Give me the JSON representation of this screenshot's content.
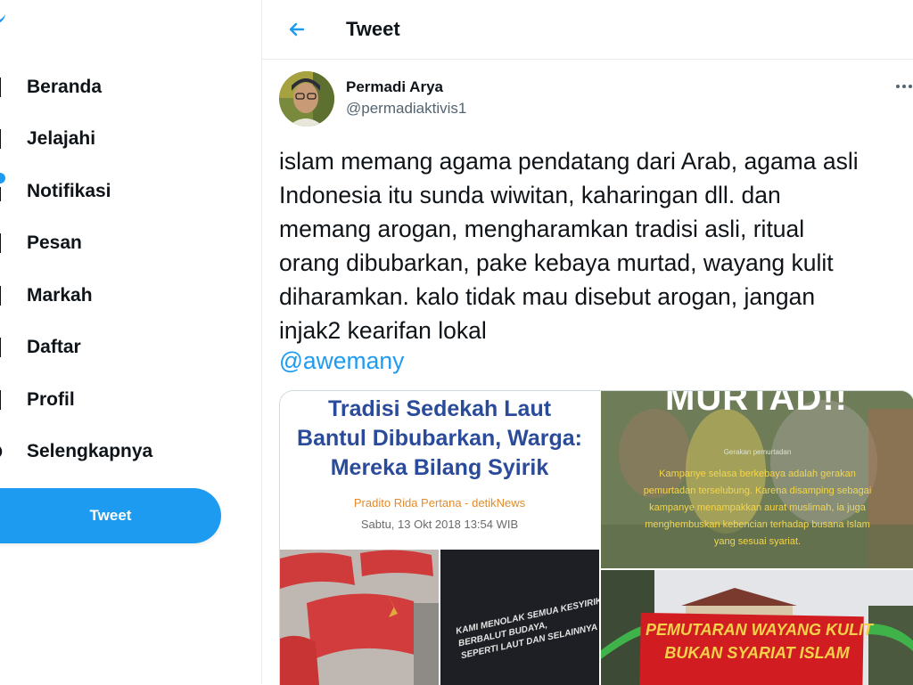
{
  "sidebar": {
    "items": [
      {
        "label": "Beranda",
        "icon": "home-icon"
      },
      {
        "label": "Jelajahi",
        "icon": "hashtag-icon"
      },
      {
        "label": "Notifikasi",
        "icon": "bell-icon"
      },
      {
        "label": "Pesan",
        "icon": "mail-icon"
      },
      {
        "label": "Markah",
        "icon": "bookmark-icon"
      },
      {
        "label": "Daftar",
        "icon": "list-icon"
      },
      {
        "label": "Profil",
        "icon": "profile-icon"
      },
      {
        "label": "Selengkapnya",
        "icon": "more-circle-icon"
      }
    ],
    "tweet_button": "Tweet"
  },
  "header": {
    "title": "Tweet"
  },
  "tweet": {
    "author_name": "Permadi Arya",
    "author_handle": "@permadiaktivis1",
    "text_lines": [
      "islam memang agama pendatang dari Arab, agama asli",
      "Indonesia itu sunda wiwitan, kaharingan dll. dan",
      "memang arogan, mengharamkan tradisi asli, ritual",
      "orang dibubarkan, pake kebaya murtad, wayang kulit",
      "diharamkan. kalo tidak mau disebut arogan, jangan",
      "injak2 kearifan lokal"
    ],
    "mention": "@awemany"
  },
  "media": {
    "news": {
      "title_lines": [
        "Tradisi Sedekah Laut",
        "Bantul Dibubarkan, Warga:",
        "Mereka Bilang Syirik"
      ],
      "author": "Pradito Rida Pertana - detikNews",
      "date": "Sabtu, 13 Okt 2018 13:54 WIB",
      "sign_lines": [
        "KAMI MENOLAK SEMUA KESYIRIKAN",
        "BERBALUT BUDAYA,",
        "SEPERTI LAUT DAN SELAINNYA"
      ]
    },
    "murtad": {
      "heading": "MURTAD!!",
      "small_label": "Gerakan pemurtadan",
      "lines": [
        "Kampanye selasa berkebaya  adalah gerakan",
        "pemurtadan terselubung. Karena disamping sebagai",
        "kampanye menampakkan aurat muslimah, ia juga",
        "menghembuskan kebencian terhadap busana Islam",
        "yang sesuai syariat."
      ]
    },
    "banner": {
      "lines": [
        "PEMUTARAN WAYANG KULIT",
        "BUKAN SYARIAT ISLAM"
      ]
    }
  },
  "colors": {
    "accent": "#1d9bf0",
    "text": "#0f1419",
    "secondary": "#536471",
    "news_title": "#2a4a9a",
    "banner": "#d11d22"
  }
}
